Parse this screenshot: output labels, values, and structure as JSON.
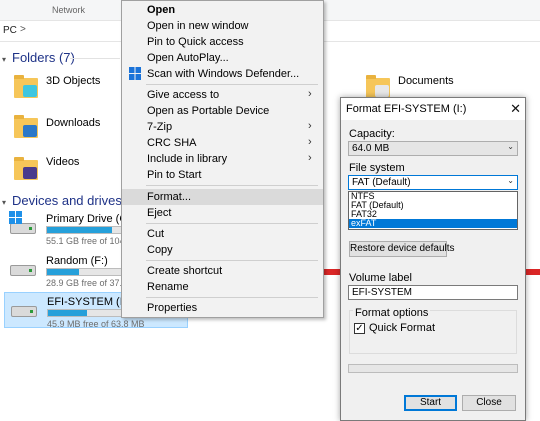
{
  "explorer": {
    "ribbon_label": "Network",
    "breadcrumb": "PC",
    "breadcrumb_sep": ">",
    "folders_section": "Folders (7)",
    "folders": [
      {
        "label": "3D Objects",
        "icon": "3d-objects-folder-icon"
      },
      {
        "label": "Downloads",
        "icon": "downloads-folder-icon"
      },
      {
        "label": "Videos",
        "icon": "videos-folder-icon"
      },
      {
        "label": "Documents",
        "icon": "documents-folder-icon"
      }
    ],
    "drives_section": "Devices and drives (7)",
    "drives": [
      {
        "name": "Primary Drive (C:)",
        "free": "55.1 GB free of 104 G",
        "used_fraction": 0.47
      },
      {
        "name": "Random (F:)",
        "free": "28.9 GB free of 37.3",
        "used_fraction": 0.23
      },
      {
        "name": "EFI-SYSTEM (I:)",
        "free": "45.9 MB free of 63.8 MB",
        "used_fraction": 0.28
      }
    ]
  },
  "context_menu": {
    "items": [
      {
        "label": "Open",
        "bold": true
      },
      {
        "label": "Open in new window"
      },
      {
        "label": "Pin to Quick access"
      },
      {
        "label": "Open AutoPlay..."
      },
      {
        "label": "Scan with Windows Defender..."
      },
      {
        "label": "Give access to",
        "submenu": true
      },
      {
        "label": "Open as Portable Device"
      },
      {
        "label": "7-Zip",
        "submenu": true
      },
      {
        "label": "CRC SHA",
        "submenu": true
      },
      {
        "label": "Include in library",
        "submenu": true
      },
      {
        "label": "Pin to Start"
      },
      {
        "label": "Format..."
      },
      {
        "label": "Eject"
      },
      {
        "label": "Cut"
      },
      {
        "label": "Copy"
      },
      {
        "label": "Create shortcut"
      },
      {
        "label": "Rename"
      },
      {
        "label": "Properties"
      }
    ],
    "submenu_arrow": "›"
  },
  "format_dialog": {
    "title": "Format EFI-SYSTEM (I:)",
    "close_glyph": "✕",
    "capacity_label": "Capacity:",
    "capacity_value": "64.0 MB",
    "filesystem_label": "File system",
    "filesystem_value": "FAT (Default)",
    "filesystem_options": [
      "NTFS",
      "FAT (Default)",
      "FAT32",
      "exFAT"
    ],
    "filesystem_highlighted": "exFAT",
    "restore_button": "Restore device defaults",
    "volume_label": "Volume label",
    "volume_value": "EFI-SYSTEM",
    "format_options_label": "Format options",
    "quick_format_label": "Quick Format",
    "quick_format_checked": true,
    "check_glyph": "✓",
    "dropdown_glyph": "⌄",
    "start_button": "Start",
    "close_button": "Close"
  },
  "colors": {
    "accent": "#0078d7",
    "drive_bar": "#26a0da",
    "selection": "#cce8ff",
    "section_header": "#1e3287"
  }
}
